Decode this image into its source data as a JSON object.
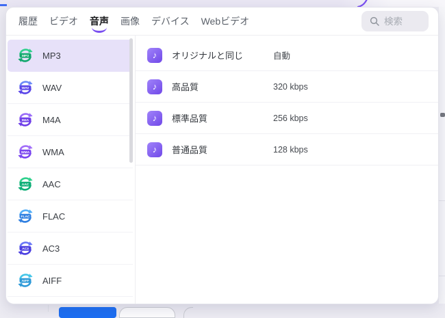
{
  "theme": {
    "accent": "#7a4ff0",
    "selected_row_bg": "#e7e1f9",
    "quality_icon_gradient": [
      "#a083fa",
      "#7048e8"
    ],
    "background_primary_button": "#1c6ef2"
  },
  "window": {
    "tabs": [
      {
        "key": "history",
        "label": "履歴",
        "active": false
      },
      {
        "key": "video",
        "label": "ビデオ",
        "active": false
      },
      {
        "key": "audio",
        "label": "音声",
        "active": true
      },
      {
        "key": "image",
        "label": "画像",
        "active": false
      },
      {
        "key": "device",
        "label": "デバイス",
        "active": false
      },
      {
        "key": "webvideo",
        "label": "Webビデオ",
        "active": false
      }
    ],
    "search": {
      "placeholder": "検索"
    }
  },
  "formats": {
    "items": [
      {
        "key": "mp3",
        "label": "MP3",
        "selected": true,
        "c1": "#2fd08d",
        "c2": "#13a86e"
      },
      {
        "key": "wav",
        "label": "WAV",
        "selected": false,
        "c1": "#6b8bf7",
        "c2": "#5a46e8"
      },
      {
        "key": "m4a",
        "label": "M4A",
        "selected": false,
        "c1": "#9a6cf8",
        "c2": "#6f3fe8"
      },
      {
        "key": "wma",
        "label": "WMA",
        "selected": false,
        "c1": "#a26ef9",
        "c2": "#7a46ef"
      },
      {
        "key": "aac",
        "label": "AAC",
        "selected": false,
        "c1": "#2fd08d",
        "c2": "#0fae77"
      },
      {
        "key": "flac",
        "label": "FLAC",
        "selected": false,
        "c1": "#52aef8",
        "c2": "#2f7fe0"
      },
      {
        "key": "ac3",
        "label": "AC3",
        "selected": false,
        "c1": "#6a78f6",
        "c2": "#4b3fe0"
      },
      {
        "key": "aiff",
        "label": "AIFF",
        "selected": false,
        "c1": "#45c6e8",
        "c2": "#2f9ad8"
      }
    ]
  },
  "qualities": {
    "icon": "music-note-icon",
    "note_glyph": "♪",
    "rows": [
      {
        "key": "original",
        "label": "オリジナルと同じ",
        "value": "自動"
      },
      {
        "key": "high",
        "label": "高品質",
        "value": "320 kbps"
      },
      {
        "key": "standard",
        "label": "標準品質",
        "value": "256 kbps"
      },
      {
        "key": "normal",
        "label": "普通品質",
        "value": "128 kbps"
      }
    ]
  }
}
